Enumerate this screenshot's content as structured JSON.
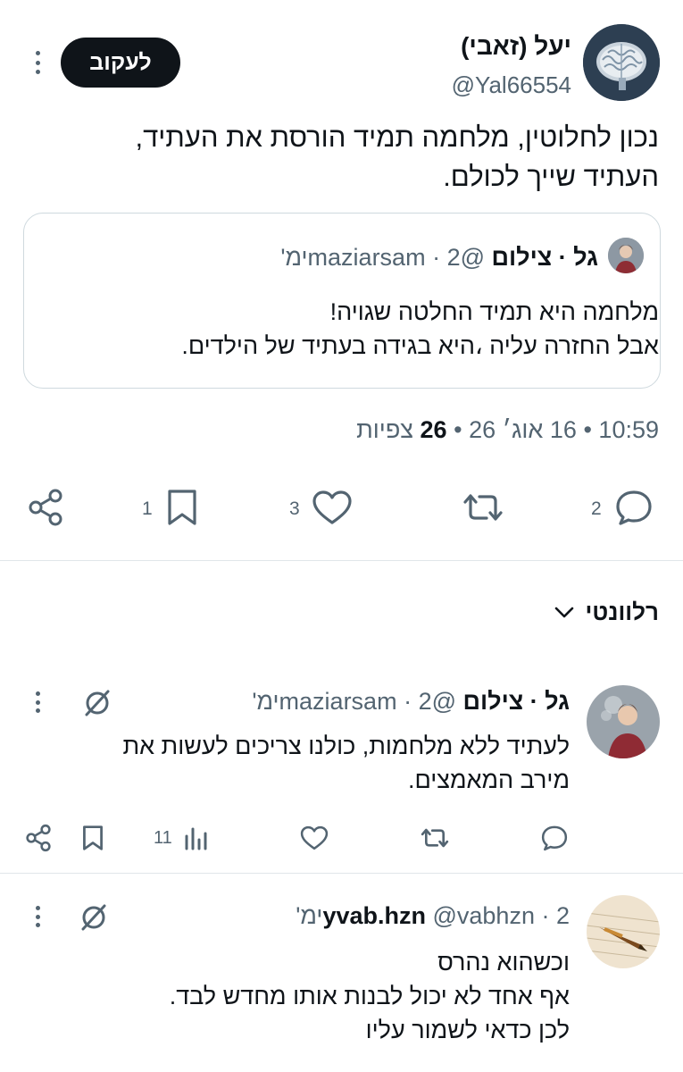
{
  "main_tweet": {
    "display_name": "יעל (זאבי)",
    "handle": "@Yal66554",
    "follow_label": "לעקוב",
    "text_lines": [
      "נכון לחלוטין, מלחמה תמיד הורסת את העתיד,",
      "העתיד שייך לכולם."
    ],
    "avatar_icon": "brain-avatar-icon",
    "quote": {
      "display_name": "גל · צילום",
      "handle": "@maziarsam",
      "time": "· 2ימ'",
      "text_lines": [
        "מלחמה היא תמיד החלטה שגויה!",
        "אבל החזרה עליה ،היא בגידה בעתיד של הילדים."
      ]
    },
    "meta": {
      "time": "10:59",
      "sep1": "•",
      "date": "16 אוג׳ 26",
      "sep2": "•",
      "views_count": "26",
      "views_label": "צפיות"
    },
    "actions": {
      "replies": "2",
      "likes": "3",
      "bookmarks": "1"
    }
  },
  "sort": {
    "label": "רלוונטי"
  },
  "replies": [
    {
      "display_name": "גל · צילום",
      "handle": "@maziarsam",
      "time": "· 2ימ'",
      "text_lines": [
        "לעתיד ללא מלחמות, כולנו צריכים לעשות את",
        "מירב המאמצים."
      ],
      "views": "11"
    },
    {
      "display_name": "yvab.hzn",
      "handle": "@vabhzn",
      "time": "· 2ימ'",
      "text_lines": [
        "וכשהוא נהרס",
        "אף אחד לא יכול לבנות אותו מחדש לבד.",
        "לכן כדאי לשמור עליו"
      ]
    }
  ],
  "colors": {
    "text": "#0f1419",
    "muted": "#536471",
    "border": "#cfd9de",
    "button_bg": "#0f1419"
  }
}
